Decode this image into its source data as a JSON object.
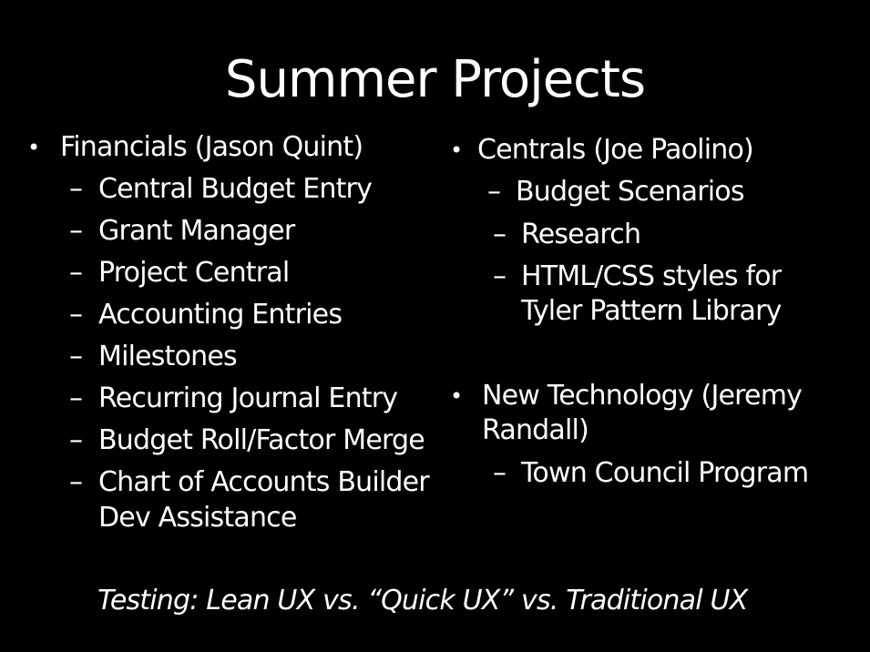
{
  "slide": {
    "title": "Summer Projects",
    "left_column": {
      "bullet": "Financials (Jason Quint)",
      "items": [
        "Central Budget Entry",
        "Grant Manager",
        "Project Central",
        "Accounting Entries",
        "Milestones",
        "Recurring Journal Entry",
        "Budget Roll/Factor Merge",
        "Chart of Accounts Builder",
        "Dev Assistance"
      ]
    },
    "right_column": {
      "bullet1": "Centrals (Joe Paolino)",
      "items1": [
        "Budget Scenarios",
        "Research",
        "HTML/CSS styles for",
        "Tyler Pattern Library"
      ],
      "bullet2_line1": "New Technology (Jeremy",
      "bullet2_line2": "Randall)",
      "items2": [
        "Town Council Program"
      ]
    },
    "footer": {
      "testing_lean": "Testing: Lean",
      "rest": " UX vs. “Quick UX”  vs. Traditional UX"
    },
    "glyphs": {
      "bullet": "•",
      "dash": "–"
    }
  }
}
